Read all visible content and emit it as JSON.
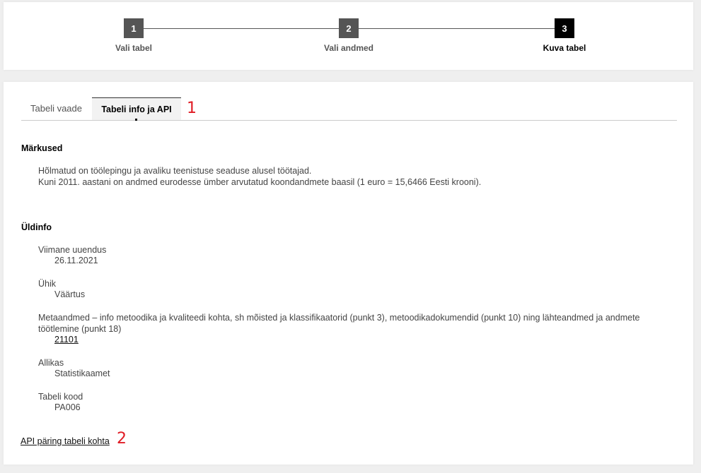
{
  "stepper": {
    "steps": [
      {
        "number": "1",
        "label": "Vali tabel"
      },
      {
        "number": "2",
        "label": "Vali andmed"
      },
      {
        "number": "3",
        "label": "Kuva tabel"
      }
    ]
  },
  "tabs": [
    {
      "label": "Tabeli vaade"
    },
    {
      "label": "Tabeli info ja API"
    }
  ],
  "markers": [
    "1",
    "2"
  ],
  "notes": {
    "title": "Märkused",
    "lines": [
      "Hõlmatud on töölepingu ja avaliku teenistuse seaduse alusel töötajad.",
      "Kuni 2011. aastani on andmed eurodesse ümber arvutatud koondandmete baasil (1 euro = 15,6466 Eesti krooni)."
    ]
  },
  "general": {
    "title": "Üldinfo",
    "last_update": {
      "label": "Viimane uuendus",
      "value": "26.11.2021"
    },
    "unit": {
      "label": "Ühik",
      "value": "Väärtus"
    },
    "metadata": {
      "label": "Metaandmed – info metoodika ja kvaliteedi kohta, sh mõisted ja klassifikaatorid (punkt 3), metoodikadokumendid (punkt 10) ning lähteandmed ja andmete töötlemine (punkt 18)",
      "value": "21101"
    },
    "source": {
      "label": "Allikas",
      "value": "Statistikaamet"
    },
    "table_code": {
      "label": "Tabeli kood",
      "value": "PA006"
    }
  },
  "api_link": "API päring tabeli kohta",
  "colors": {
    "active_step": "#000000",
    "inactive_step": "#555555",
    "marker": "#e01b24"
  }
}
